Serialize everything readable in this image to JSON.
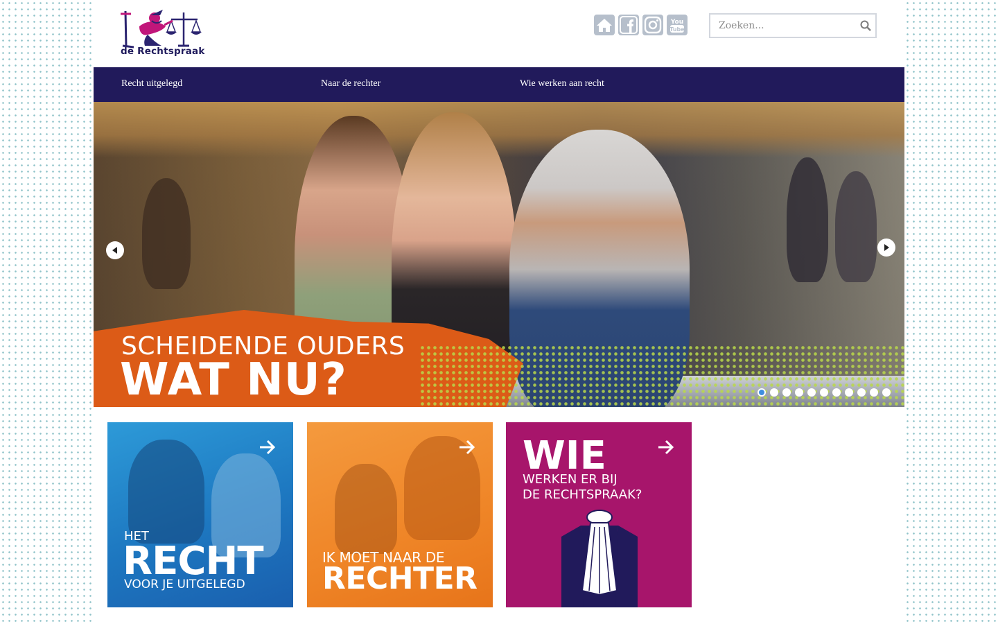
{
  "header": {
    "logo_text": "de Rechtspraak",
    "social_icons": [
      "home-icon",
      "facebook-icon",
      "instagram-icon",
      "youtube-icon"
    ],
    "search_placeholder": "Zoeken..."
  },
  "nav": {
    "items": [
      {
        "label": "Recht uitgelegd"
      },
      {
        "label": "Naar de rechter"
      },
      {
        "label": "Wie werken aan recht"
      }
    ]
  },
  "hero": {
    "line1": "SCHEIDENDE OUDERS",
    "line2": "WAT NU?",
    "slide_count": 11,
    "active_slide": 1
  },
  "tiles": [
    {
      "small": "HET",
      "big": "RECHT",
      "sub": "VOOR JE UITGELEGD",
      "color": "#1e7fc6"
    },
    {
      "small": "IK MOET NAAR DE",
      "big": "RECHTER",
      "color": "#f08a2c"
    },
    {
      "big": "WIE",
      "sub": "WERKEN ER BIJ",
      "sub2": "DE RECHTSPRAAK?",
      "color": "#a7156b"
    }
  ],
  "colors": {
    "nav_bg": "#211a5b",
    "accent_orange": "#dc5b17",
    "social_icon_bg": "#b6bfcb"
  }
}
